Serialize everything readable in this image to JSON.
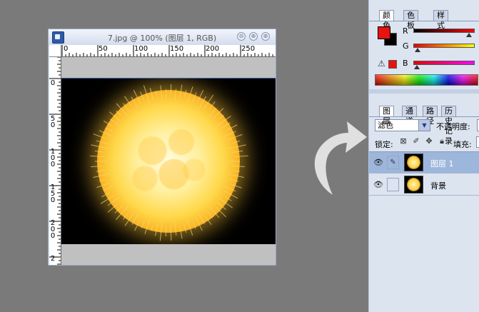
{
  "document": {
    "title": "7.jpg @ 100% (图层 1, RGB)",
    "ruler_h_labels": [
      "0",
      "50",
      "100",
      "150",
      "200",
      "250"
    ],
    "ruler_v_labels": [
      "0",
      "5 0",
      "1 0 0",
      "1 5 0",
      "2 0 0",
      "2"
    ],
    "buttons": {
      "minimize": "⊖",
      "maximize": "⊕",
      "close": "⊗"
    }
  },
  "color_panel": {
    "tabs": [
      "颜色",
      "色板",
      "样式"
    ],
    "active_tab": 0,
    "foreground_color": "#e8120e",
    "background_color": "#000000",
    "channels": [
      {
        "label": "R",
        "gradient": "linear-gradient(to right,#000,#ff0000)",
        "value_fraction": 0.91
      },
      {
        "label": "G",
        "gradient": "linear-gradient(to right,#e80000,#ffff00)",
        "value_fraction": 0.07
      },
      {
        "label": "B",
        "gradient": "linear-gradient(to right,#e80000,#ff00ff)",
        "value_fraction": 0.06
      }
    ]
  },
  "layers_panel": {
    "tabs": [
      "图层",
      "通道",
      "路径",
      "历史记录"
    ],
    "active_tab": 0,
    "blend_mode": "滤色",
    "opacity_label": "不透明度:",
    "lock_label": "锁定:",
    "lock_icons": [
      "lock-transparent-icon",
      "lock-brush-icon",
      "lock-move-icon",
      "lock-all-icon"
    ],
    "fill_label": "填充:",
    "layers": [
      {
        "name": "图层 1",
        "visible": true,
        "selected": true,
        "thumb": "sun"
      },
      {
        "name": "背景",
        "visible": true,
        "selected": false,
        "thumb": "sun"
      }
    ]
  },
  "colors": {
    "workspace": "#7a7a7a",
    "panel": "#dce4f0",
    "selected_layer": "#9db6db",
    "arrow": "#e0e0e0"
  }
}
